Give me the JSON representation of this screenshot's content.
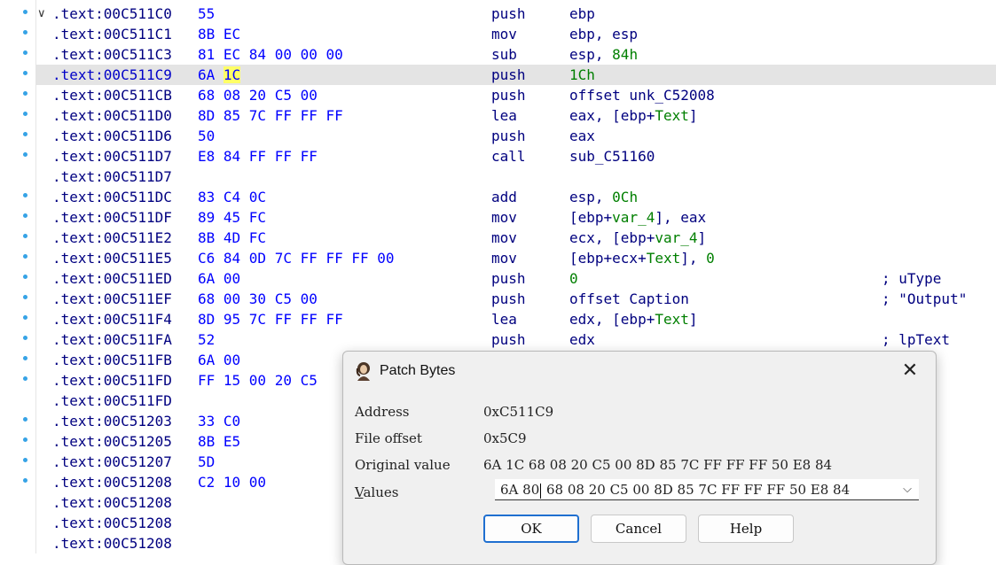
{
  "listing": [
    {
      "collapse": "∨",
      "addr": ".text:00C511C0",
      "bytes": "55",
      "mnem": "push",
      "ops": [
        {
          "t": "ebp"
        }
      ],
      "comment": "",
      "dot": true
    },
    {
      "addr": ".text:00C511C1",
      "bytes": "8B EC",
      "mnem": "mov",
      "ops": [
        {
          "t": "ebp, esp"
        }
      ],
      "comment": "",
      "dot": true
    },
    {
      "addr": ".text:00C511C3",
      "bytes": "81 EC 84 00 00 00",
      "mnem": "sub",
      "ops": [
        {
          "t": "esp, "
        },
        {
          "t": "84h",
          "n": true
        }
      ],
      "comment": "",
      "dot": true
    },
    {
      "addr": ".text:00C511C9",
      "bytes_pre": "6A ",
      "bytes_hl": "1C",
      "mnem": "push",
      "ops": [
        {
          "t": "1Ch",
          "n": true
        }
      ],
      "comment": "",
      "dot": true,
      "selected": true
    },
    {
      "addr": ".text:00C511CB",
      "bytes": "68 08 20 C5 00",
      "mnem": "push",
      "ops": [
        {
          "t": "offset unk_C52008"
        }
      ],
      "comment": "",
      "dot": true
    },
    {
      "addr": ".text:00C511D0",
      "bytes": "8D 85 7C FF FF FF",
      "mnem": "lea",
      "ops": [
        {
          "t": "eax, [ebp+"
        },
        {
          "t": "Text",
          "n": true
        },
        {
          "t": "]"
        }
      ],
      "comment": "",
      "dot": true
    },
    {
      "addr": ".text:00C511D6",
      "bytes": "50",
      "mnem": "push",
      "ops": [
        {
          "t": "eax"
        }
      ],
      "comment": "",
      "dot": true
    },
    {
      "addr": ".text:00C511D7",
      "bytes": "E8 84 FF FF FF",
      "mnem": "call",
      "ops": [
        {
          "t": "sub_C51160"
        }
      ],
      "comment": "",
      "dot": true
    },
    {
      "addr": ".text:00C511D7",
      "bytes": "",
      "mnem": "",
      "ops": [],
      "comment": "",
      "dot": false
    },
    {
      "addr": ".text:00C511DC",
      "bytes": "83 C4 0C",
      "mnem": "add",
      "ops": [
        {
          "t": "esp, "
        },
        {
          "t": "0Ch",
          "n": true
        }
      ],
      "comment": "",
      "dot": true
    },
    {
      "addr": ".text:00C511DF",
      "bytes": "89 45 FC",
      "mnem": "mov",
      "ops": [
        {
          "t": "[ebp+"
        },
        {
          "t": "var_4",
          "n": true
        },
        {
          "t": "], eax"
        }
      ],
      "comment": "",
      "dot": true
    },
    {
      "addr": ".text:00C511E2",
      "bytes": "8B 4D FC",
      "mnem": "mov",
      "ops": [
        {
          "t": "ecx, [ebp+"
        },
        {
          "t": "var_4",
          "n": true
        },
        {
          "t": "]"
        }
      ],
      "comment": "",
      "dot": true
    },
    {
      "addr": ".text:00C511E5",
      "bytes": "C6 84 0D 7C FF FF FF 00",
      "mnem": "mov",
      "ops": [
        {
          "t": "[ebp+ecx+"
        },
        {
          "t": "Text",
          "n": true
        },
        {
          "t": "], "
        },
        {
          "t": "0",
          "n": true
        }
      ],
      "comment": "",
      "dot": true
    },
    {
      "addr": ".text:00C511ED",
      "bytes": "6A 00",
      "mnem": "push",
      "ops": [
        {
          "t": "0",
          "n": true
        }
      ],
      "comment": "; uType",
      "dot": true
    },
    {
      "addr": ".text:00C511EF",
      "bytes": "68 00 30 C5 00",
      "mnem": "push",
      "ops": [
        {
          "t": "offset Caption"
        }
      ],
      "comment": "; \"Output\"",
      "dot": true
    },
    {
      "addr": ".text:00C511F4",
      "bytes": "8D 95 7C FF FF FF",
      "mnem": "lea",
      "ops": [
        {
          "t": "edx, [ebp+"
        },
        {
          "t": "Text",
          "n": true
        },
        {
          "t": "]"
        }
      ],
      "comment": "",
      "dot": true
    },
    {
      "addr": ".text:00C511FA",
      "bytes": "52",
      "mnem": "push",
      "ops": [
        {
          "t": "edx"
        }
      ],
      "comment": "; lpText",
      "dot": true
    },
    {
      "addr": ".text:00C511FB",
      "bytes": "6A 00",
      "mnem": "",
      "ops": [],
      "comment": "",
      "dot": true
    },
    {
      "addr": ".text:00C511FD",
      "bytes": "FF 15 00 20 C5",
      "mnem": "",
      "ops": [],
      "comment": "",
      "dot": true
    },
    {
      "addr": ".text:00C511FD",
      "bytes": "",
      "mnem": "",
      "ops": [],
      "comment": "",
      "dot": false
    },
    {
      "addr": ".text:00C51203",
      "bytes": "33 C0",
      "mnem": "",
      "ops": [],
      "comment": "",
      "dot": true
    },
    {
      "addr": ".text:00C51205",
      "bytes": "8B E5",
      "mnem": "",
      "ops": [],
      "comment": "",
      "dot": true
    },
    {
      "addr": ".text:00C51207",
      "bytes": "5D",
      "mnem": "",
      "ops": [],
      "comment": "",
      "dot": true
    },
    {
      "addr": ".text:00C51208",
      "bytes": "C2 10 00",
      "mnem": "",
      "ops": [],
      "comment": "",
      "dot": true
    },
    {
      "addr": ".text:00C51208",
      "bytes": "",
      "mnem": "",
      "ops": [],
      "comment": "",
      "dot": false
    },
    {
      "addr": ".text:00C51208",
      "bytes": "",
      "mnem": "",
      "ops": [],
      "comment": "",
      "dot": false
    },
    {
      "addr": ".text:00C51208",
      "bytes": "",
      "mnem": "",
      "ops": [],
      "comment": "",
      "dot": false
    }
  ],
  "dialog": {
    "title": "Patch Bytes",
    "close_glyph": "✕",
    "address_label": "Address",
    "address_value": "0xC511C9",
    "file_offset_label": "File offset",
    "file_offset_value": "0x5C9",
    "original_label": "Original value",
    "original_value": "6A 1C 68 08 20 C5 00 8D 85 7C FF FF FF 50 E8 84",
    "values_label_first": "V",
    "values_label_rest": "alues",
    "values_before_caret": "6A 80",
    "values_after_caret": " 68 08 20 C5 00 8D 85 7C FF FF FF 50 E8 84",
    "dropdown_glyph": "⌵",
    "ok_label": "OK",
    "cancel_label": "Cancel",
    "help_label": "Help"
  },
  "colors": {
    "accent": "#1f6fd0",
    "highlight": "#ffff66",
    "selected_row": "#e4e4e4",
    "address": "#000080",
    "bytes": "#0000ff",
    "number": "#007f00"
  }
}
